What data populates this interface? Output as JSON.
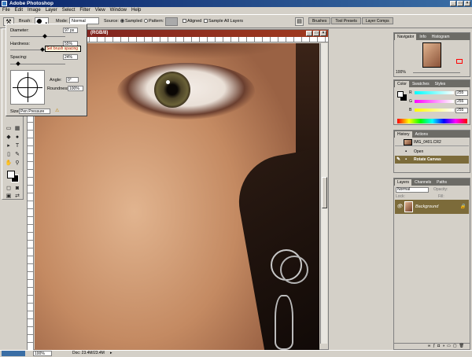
{
  "app": {
    "title": "Adobe Photoshop"
  },
  "menu": [
    "File",
    "Edit",
    "Image",
    "Layer",
    "Select",
    "Filter",
    "View",
    "Window",
    "Help"
  ],
  "options": {
    "brush_label": "Brush:",
    "brush_size": "97",
    "mode_label": "Mode:",
    "mode_value": "Normal",
    "source_label": "Source:",
    "sampled": "Sampled",
    "pattern": "Pattern:",
    "aligned": "Aligned",
    "sample_all": "Sample All Layers"
  },
  "palette_well": [
    "Brushes",
    "Tool Presets",
    "Layer Comps"
  ],
  "document": {
    "title": "(RGB/8)"
  },
  "brush_popup": {
    "diameter_label": "Diameter:",
    "diameter_value": "97 px",
    "hardness_label": "Hardness:",
    "hardness_value": "55%",
    "spacing_label": "Spacing:",
    "spacing_value": "24%",
    "tooltip": "Set brush spacing",
    "angle_label": "Angle:",
    "angle_value": "0°",
    "roundness_label": "Roundness:",
    "roundness_value": "100%",
    "size_label": "Size:",
    "size_value": "Pen Pressure",
    "diameter_fraction": 0.6,
    "hardness_fraction": 0.55,
    "spacing_fraction": 0.12
  },
  "navigator": {
    "tabs": [
      "Navigator",
      "Info",
      "Histogram"
    ],
    "zoom": "100%"
  },
  "color": {
    "tabs": [
      "Color",
      "Swatches",
      "Styles"
    ],
    "r_label": "R",
    "r_value": "255",
    "g_label": "G",
    "g_value": "255",
    "b_label": "B",
    "b_value": "255"
  },
  "history": {
    "tabs": [
      "History",
      "Actions"
    ],
    "snapshot": "IMG_0401.CR2",
    "items": [
      "Open",
      "Rotate Canvas"
    ]
  },
  "layers": {
    "tabs": [
      "Layers",
      "Channels",
      "Paths"
    ],
    "blend_mode": "Normal",
    "opacity_label": "Opacity:",
    "fill_label": "Fill:",
    "lock_label": "Lock:",
    "layer_name": "Background"
  },
  "status": {
    "zoom": "100%",
    "doc": "Doc: 23.4M/23.4M"
  },
  "colors": {
    "foreground": "#ffffff",
    "background": "#000000",
    "history_selected": "#7c6b3a"
  }
}
